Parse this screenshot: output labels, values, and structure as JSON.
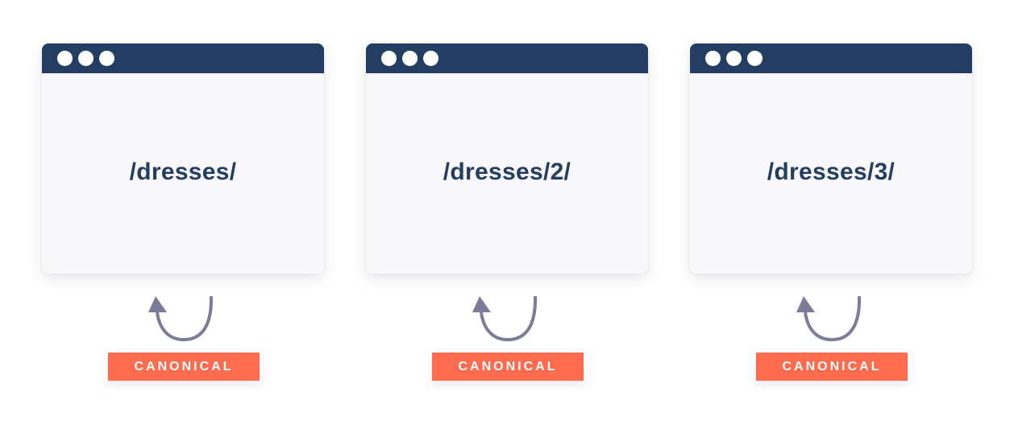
{
  "pages": [
    {
      "url": "/dresses/",
      "badge": "CANONICAL"
    },
    {
      "url": "/dresses/2/",
      "badge": "CANONICAL"
    },
    {
      "url": "/dresses/3/",
      "badge": "CANONICAL"
    }
  ],
  "colors": {
    "titlebar": "#243e63",
    "window_bg": "#f8f8fa",
    "url_text": "#243e63",
    "arrow": "#7a7c99",
    "badge_bg": "#ff6b4f",
    "badge_text": "#ffffff"
  }
}
